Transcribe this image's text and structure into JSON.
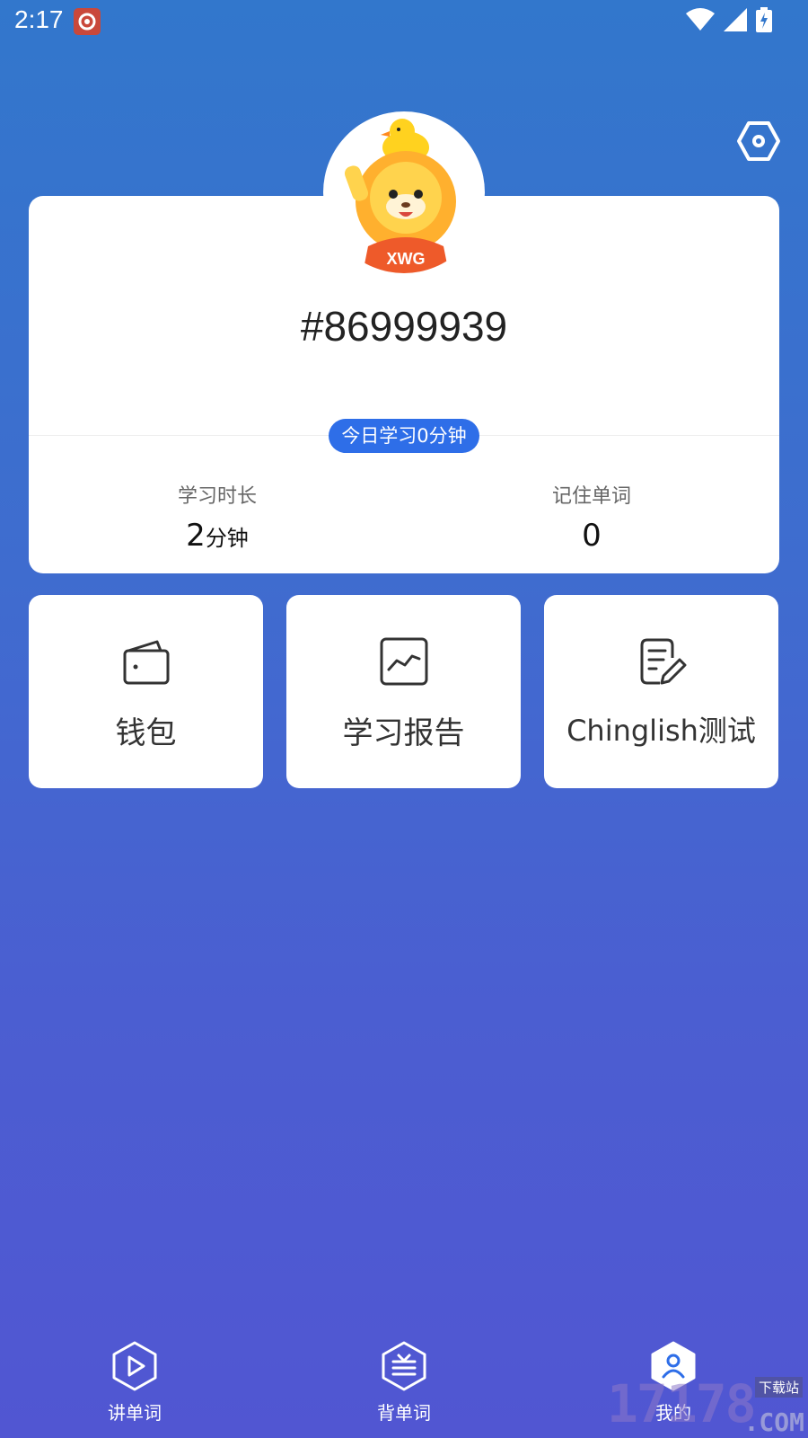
{
  "status_bar": {
    "time": "2:17",
    "icons": [
      "wifi-icon",
      "signal-icon",
      "battery-charging-icon"
    ]
  },
  "header": {
    "settings_icon": "hexagon-settings-icon"
  },
  "profile": {
    "user_id": "#86999939",
    "avatar_text": "XWG",
    "today_badge": "今日学习0分钟",
    "stats": {
      "duration_label": "学习时长",
      "duration_value": "2",
      "duration_unit": "分钟",
      "words_label": "记住单词",
      "words_value": "0"
    }
  },
  "tiles": {
    "wallet": "钱包",
    "report": "学习报告",
    "test": "Chinglish测试"
  },
  "nav": {
    "speak": "讲单词",
    "memorize": "背单词",
    "mine": "我的"
  },
  "watermark": {
    "main": "17178",
    "sub": "下载站",
    "com": ".COM"
  },
  "colors": {
    "accent": "#2e6ee8",
    "bg_top": "#3277cc",
    "bg_bottom": "#5156d2"
  }
}
